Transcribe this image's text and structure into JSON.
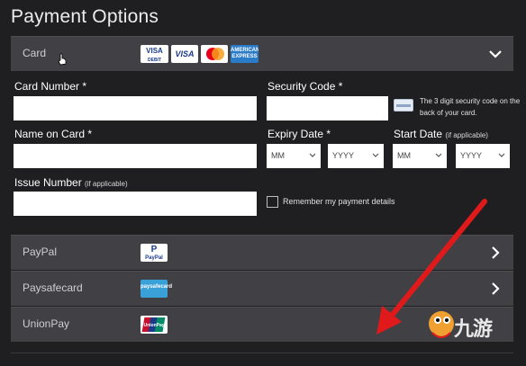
{
  "page": {
    "title": "Payment Options"
  },
  "card_section": {
    "label": "Card",
    "logos": {
      "visa_debit": "VISA DEBIT",
      "visa": "VISA",
      "mastercard": "mastercard",
      "amex": "AMERICAN EXPRESS"
    },
    "expanded": true
  },
  "form": {
    "card_number_label": "Card Number *",
    "card_number_value": "",
    "security_code_label": "Security Code *",
    "security_code_value": "",
    "security_note": "The 3 digit security code on the back of your card.",
    "name_label": "Name on Card *",
    "name_value": "",
    "expiry_label": "Expiry Date *",
    "start_label": "Start Date",
    "start_hint": "(if applicable)",
    "expiry_month": "MM",
    "expiry_year": "YYYY",
    "start_month": "MM",
    "start_year": "YYYY",
    "issue_label": "Issue Number",
    "issue_hint": "(if applicable)",
    "issue_value": "",
    "remember_label": "Remember my payment details",
    "remember_checked": false
  },
  "methods": [
    {
      "label": "PayPal",
      "logo_text": "PayPal",
      "logo_color": "#1a3a8a",
      "has_chevron": true
    },
    {
      "label": "Paysafecard",
      "logo_text": "paysafecard",
      "logo_color": "#ffffff",
      "has_chevron": true
    },
    {
      "label": "UnionPay",
      "logo_text": "UnionPay",
      "logo_color": "#c8102e",
      "has_chevron": false
    }
  ],
  "watermark": {
    "text": "九游"
  },
  "colors": {
    "background": "#1f1f21",
    "section_bg": "#404045",
    "arrow": "#e01a1a"
  }
}
